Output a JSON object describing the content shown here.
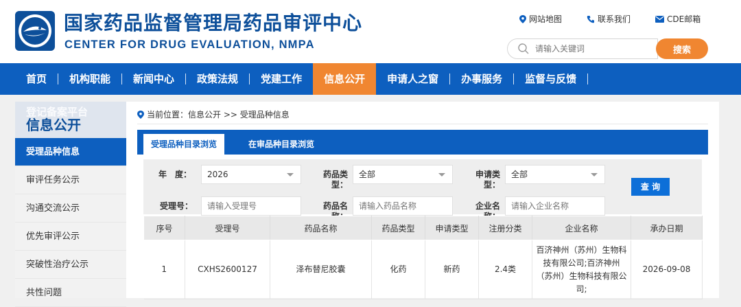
{
  "site": {
    "title_cn": "国家药品监督管理局药品审评中心",
    "title_en": "CENTER FOR DRUG EVALUATION, NMPA"
  },
  "toplinks": [
    {
      "label": "网站地图",
      "icon": "location-pin-icon"
    },
    {
      "label": "联系我们",
      "icon": "phone-icon"
    },
    {
      "label": "CDE邮箱",
      "icon": "mail-icon"
    }
  ],
  "search": {
    "placeholder": "请输入关键词",
    "button": "搜索"
  },
  "nav": [
    {
      "label": "首页"
    },
    {
      "label": "机构职能"
    },
    {
      "label": "新闻中心"
    },
    {
      "label": "政策法规"
    },
    {
      "label": "党建工作"
    },
    {
      "label": "信息公开",
      "active": true
    },
    {
      "label": "申请人之窗"
    },
    {
      "label": "办事服务"
    },
    {
      "label": "监督与反馈"
    }
  ],
  "sidebar": {
    "ghost_title": "登记备案平台",
    "title": "信息公开",
    "items": [
      {
        "label": "受理品种信息",
        "active": true
      },
      {
        "label": "审评任务公示"
      },
      {
        "label": "沟通交流公示"
      },
      {
        "label": "优先审评公示"
      },
      {
        "label": "突破性治疗公示"
      },
      {
        "label": "共性问题"
      }
    ]
  },
  "breadcrumb": "当前位置：信息公开 >> 受理品种信息",
  "tabs": [
    {
      "label": "受理品种目录浏览",
      "active": true
    },
    {
      "label": "在审品种目录浏览"
    }
  ],
  "filters": {
    "year_label": "年　度：",
    "year_value": "2026",
    "drug_type_label": "药品类型：",
    "drug_type_value": "全部",
    "apply_type_label": "申请类型：",
    "apply_type_value": "全部",
    "accept_no_label": "受理号：",
    "accept_no_placeholder": "请输入受理号",
    "drug_name_label": "药品名称：",
    "drug_name_placeholder": "请输入药品名称",
    "company_label": "企业名称：",
    "company_placeholder": "请输入企业名称",
    "query_button": "查 询"
  },
  "table": {
    "headers": [
      "序号",
      "受理号",
      "药品名称",
      "药品类型",
      "申请类型",
      "注册分类",
      "企业名称",
      "承办日期"
    ],
    "rows": [
      [
        "1",
        "CXHS2600127",
        "泽布替尼胶囊",
        "化药",
        "新药",
        "2.4类",
        "百济神州（苏州）生物科技有限公司;百济神州（苏州）生物科技有限公司;",
        "2026-09-08"
      ]
    ]
  },
  "colors": {
    "brand_blue": "#0d5fbf",
    "accent_orange": "#f08631",
    "title_blue": "#0d4f9a"
  }
}
